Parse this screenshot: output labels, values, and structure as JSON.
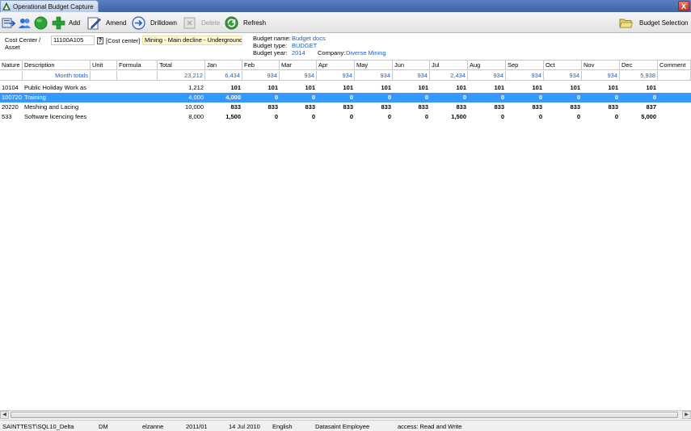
{
  "window": {
    "title": "Operational Budget Capture",
    "close_label": "X"
  },
  "toolbar": {
    "add_label": "Add",
    "amend_label": "Amend",
    "drilldown_label": "Drilldown",
    "delete_label": "Delete",
    "refresh_label": "Refresh",
    "budget_selection_label": "Budget Selection"
  },
  "header": {
    "cost_center_label": "Cost Center  /",
    "asset_label": "Asset",
    "cost_center_value": "11100A105",
    "lookup_label": "?",
    "cost_center_type": "[Cost center]",
    "cost_center_desc": "Mining - Main decline - Underground -",
    "budget_name_label": "Budget name:",
    "budget_name": "Budget docs",
    "budget_type_label": "Budget type:",
    "budget_type": "BUDGET",
    "budget_year_label": "Budget year:",
    "budget_year": "2014",
    "company_label": "Company:",
    "company": "Diverse Mining"
  },
  "grid": {
    "columns": [
      "Nature",
      "Description",
      "Unit",
      "Formula",
      "Total",
      "Jan",
      "Feb",
      "Mar",
      "Apr",
      "May",
      "Jun",
      "Jul",
      "Aug",
      "Sep",
      "Oct",
      "Nov",
      "Dec",
      "Comment"
    ],
    "totals": {
      "label": "Month totals",
      "total": "23,212",
      "months": [
        "6,434",
        "934",
        "934",
        "934",
        "934",
        "934",
        "2,434",
        "934",
        "934",
        "934",
        "934",
        "5,938"
      ]
    },
    "rows": [
      {
        "nature": "10104",
        "description": "Public Holiday Work as",
        "total": "1,212",
        "months": [
          "101",
          "101",
          "101",
          "101",
          "101",
          "101",
          "101",
          "101",
          "101",
          "101",
          "101",
          "101"
        ],
        "selected": false
      },
      {
        "nature": "100720",
        "description": "Training",
        "total": "4,000",
        "months": [
          "4,000",
          "0",
          "0",
          "0",
          "0",
          "0",
          "0",
          "0",
          "0",
          "0",
          "0",
          "0"
        ],
        "selected": true
      },
      {
        "nature": "20220",
        "description": "Meshing and Lacing",
        "total": "10,000",
        "months": [
          "833",
          "833",
          "833",
          "833",
          "833",
          "833",
          "833",
          "833",
          "833",
          "833",
          "833",
          "837"
        ],
        "selected": false
      },
      {
        "nature": "533",
        "description": "Software licencing fees",
        "total": "8,000",
        "months": [
          "1,500",
          "0",
          "0",
          "0",
          "0",
          "0",
          "1,500",
          "0",
          "0",
          "0",
          "0",
          "5,000"
        ],
        "selected": false
      }
    ]
  },
  "status_bar": {
    "server": "SAINTTEST\\SQL10_Delta",
    "module": "DM",
    "user": "elzanne",
    "period": "2011/01",
    "date": "14 Jul 2010",
    "language": "English",
    "company": "Datasaint Employee",
    "access": "access: Read and Write"
  },
  "colors": {
    "selection": "#3399ff",
    "link_blue": "#1f5fb8",
    "titlebar": "#3f63a8"
  }
}
